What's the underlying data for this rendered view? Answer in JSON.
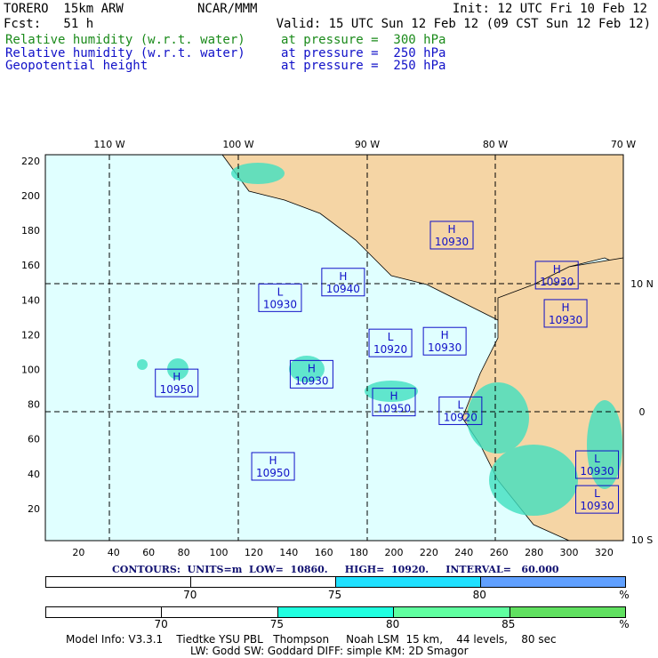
{
  "header": {
    "model": "TORERO  15km ARW",
    "org": "NCAR/MMM",
    "init": "Init: 12 UTC Fri 10 Feb 12",
    "fcst": "Fcst:   51 h",
    "valid": "Valid: 15 UTC Sun 12 Feb 12 (09 CST Sun 12 Feb 12)",
    "fields": [
      {
        "name": "Relative humidity (w.r.t. water)",
        "level": "at pressure =  300 hPa",
        "color": "#1a8a1a"
      },
      {
        "name": "Relative humidity (w.r.t. water)",
        "level": "at pressure =  250 hPa",
        "color": "#1010c8"
      },
      {
        "name": "Geopotential height",
        "level": "at pressure =  250 hPa",
        "color": "#1010c8"
      }
    ]
  },
  "chart_data": {
    "type": "contour-map",
    "lon_labels": [
      "110 W",
      "100 W",
      "90 W",
      "80 W",
      "70 W"
    ],
    "lat_labels": [
      "10 N",
      "0",
      "10 S"
    ],
    "x_ticks": [
      20,
      40,
      60,
      80,
      100,
      120,
      140,
      160,
      180,
      200,
      220,
      240,
      260,
      280,
      300,
      320
    ],
    "y_ticks": [
      20,
      40,
      60,
      80,
      100,
      120,
      140,
      160,
      180,
      200,
      220
    ],
    "centers": [
      {
        "type": "H",
        "value": "10930",
        "x": 233,
        "y": 177
      },
      {
        "type": "H",
        "value": "10940",
        "x": 171,
        "y": 150
      },
      {
        "type": "L",
        "value": "10930",
        "x": 135,
        "y": 141
      },
      {
        "type": "H",
        "value": "10930",
        "x": 293,
        "y": 154
      },
      {
        "type": "H",
        "value": "10930",
        "x": 298,
        "y": 132
      },
      {
        "type": "L",
        "value": "10920",
        "x": 198,
        "y": 115
      },
      {
        "type": "H",
        "value": "10930",
        "x": 229,
        "y": 116
      },
      {
        "type": "H",
        "value": "10950",
        "x": 76,
        "y": 92
      },
      {
        "type": "H",
        "value": "10930",
        "x": 153,
        "y": 97
      },
      {
        "type": "H",
        "value": "10950",
        "x": 200,
        "y": 81
      },
      {
        "type": "L",
        "value": "10920",
        "x": 238,
        "y": 76
      },
      {
        "type": "H",
        "value": "10950",
        "x": 131,
        "y": 44
      },
      {
        "type": "L",
        "value": "10930",
        "x": 316,
        "y": 45
      },
      {
        "type": "L",
        "value": "10930",
        "x": 316,
        "y": 25
      }
    ],
    "contour_info": "CONTOURS:  UNITS=m  LOW=  10860.     HIGH=  10920.     INTERVAL=   60.000",
    "colorbar_250": {
      "labels": [
        "70",
        "75",
        "80",
        "%"
      ],
      "colors": [
        "#ffffff",
        "#ffffff",
        "#20e0ff",
        "#60a0ff"
      ]
    },
    "colorbar_300": {
      "labels": [
        "70",
        "75",
        "80",
        "85",
        "%"
      ],
      "colors": [
        "#ffffff",
        "#ffffff",
        "#20ffe0",
        "#60ffa0",
        "#60e060"
      ]
    }
  },
  "footer": {
    "line1": "Model Info: V3.3.1    Tiedtke YSU PBL   Thompson     Noah LSM  15 km,    44 levels,    80 sec",
    "line2": "LW: Godd SW: Goddard DIFF: simple KM: 2D Smagor"
  }
}
